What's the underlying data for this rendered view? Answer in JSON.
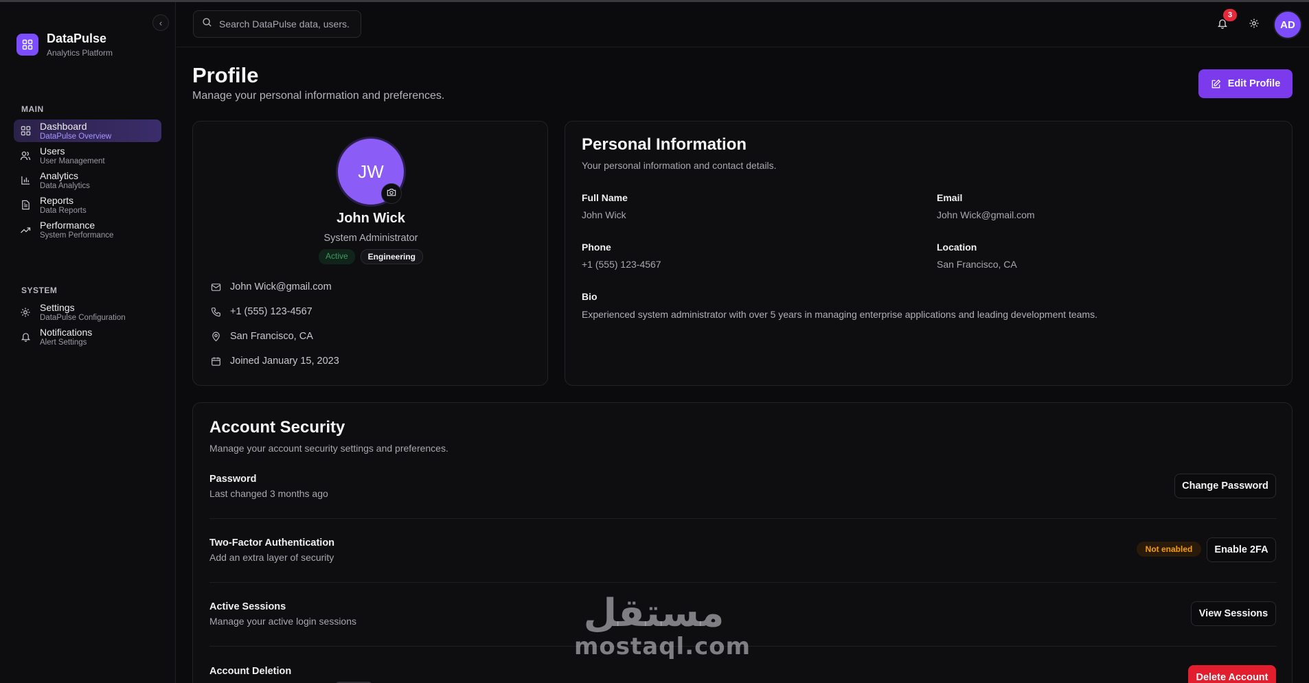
{
  "brand": {
    "name": "DataPulse",
    "subtitle": "Analytics Platform"
  },
  "sidebar": {
    "sections": [
      {
        "title": "MAIN"
      },
      {
        "title": "SYSTEM"
      }
    ],
    "items": [
      {
        "label": "Dashboard",
        "sub": "DataPulse Overview",
        "icon": "grid-icon",
        "active": true
      },
      {
        "label": "Users",
        "sub": "User Management",
        "icon": "users-icon"
      },
      {
        "label": "Analytics",
        "sub": "Data Analytics",
        "icon": "bar-chart-icon"
      },
      {
        "label": "Reports",
        "sub": "Data Reports",
        "icon": "file-text-icon"
      },
      {
        "label": "Performance",
        "sub": "System Performance",
        "icon": "trending-up-icon"
      },
      {
        "label": "Settings",
        "sub": "DataPulse Configuration",
        "icon": "gear-icon"
      },
      {
        "label": "Notifications",
        "sub": "Alert Settings",
        "icon": "bell-icon"
      }
    ],
    "collapse_glyph": "‹"
  },
  "topbar": {
    "search_placeholder": "Search DataPulse data, users...",
    "notification_count": "3",
    "avatar_initials": "AD"
  },
  "header": {
    "title": "Profile",
    "subtitle": "Manage your personal information and preferences.",
    "edit_label": "Edit Profile"
  },
  "profile": {
    "initials": "JW",
    "name": "John Wick",
    "role": "System Administrator",
    "status": "Active",
    "department": "Engineering",
    "email": "John Wick@gmail.com",
    "phone": "+1 (555) 123-4567",
    "location": "San Francisco, CA",
    "joined": "Joined January 15, 2023"
  },
  "personal_info": {
    "title": "Personal Information",
    "subtitle": "Your personal information and contact details.",
    "full_name_label": "Full Name",
    "full_name": "John Wick",
    "email_label": "Email",
    "email": "John Wick@gmail.com",
    "phone_label": "Phone",
    "phone": "+1 (555) 123-4567",
    "location_label": "Location",
    "location": "San Francisco, CA",
    "bio_label": "Bio",
    "bio": "Experienced system administrator with over 5 years in managing enterprise applications and leading development teams."
  },
  "security": {
    "title": "Account Security",
    "subtitle": "Manage your account security settings and preferences.",
    "password_title": "Password",
    "password_sub": "Last changed 3 months ago",
    "password_btn": "Change Password",
    "tfa_title": "Two-Factor Authentication",
    "tfa_sub": "Add an extra layer of security",
    "tfa_status": "Not enabled",
    "tfa_btn": "Enable 2FA",
    "sessions_title": "Active Sessions",
    "sessions_sub": "Manage your active login sessions",
    "sessions_btn": "View Sessions",
    "deletion_title": "Account Deletion",
    "deletion_btn": "Delete Account"
  },
  "watermark": {
    "arabic": "مستقل",
    "latin": "mostaql.com"
  },
  "colors": {
    "accent": "#7c3aed",
    "danger": "#e11d2e",
    "warning": "#f59e0b",
    "success": "#3f9b61"
  }
}
